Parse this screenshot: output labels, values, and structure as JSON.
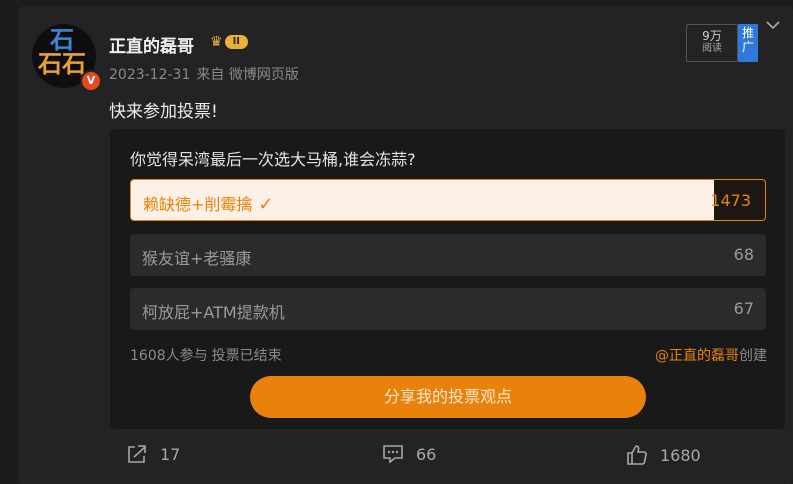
{
  "post": {
    "author": "正直的磊哥",
    "level": "II",
    "verified_mark": "V",
    "date": "2023-12-31",
    "source": "来自 微博网页版",
    "read_count": "9万",
    "read_label": "阅读",
    "recommend_label": "推广",
    "text": "快来参加投票!"
  },
  "avatar": {
    "chars": [
      "石",
      "石",
      "石"
    ]
  },
  "poll": {
    "question": "你觉得呆湾最后一次选大马桶,谁会冻蒜?",
    "options": [
      {
        "label": "赖缺德+削霉擒",
        "count": "1473",
        "share": 0.92,
        "selected": true
      },
      {
        "label": "猴友谊+老骚康",
        "count": "68",
        "share": 0.04,
        "selected": false
      },
      {
        "label": "柯放屁+ATM提款机",
        "count": "67",
        "share": 0.04,
        "selected": false
      }
    ],
    "participants": "1608人参与",
    "status": "投票已结束",
    "creator_mention": "@正直的磊哥",
    "creator_suffix": "创建",
    "share_button": "分享我的投票观点"
  },
  "actions": {
    "repost": {
      "icon": "share-icon",
      "count": "17"
    },
    "comment": {
      "icon": "comment-icon",
      "count": "66"
    },
    "like": {
      "icon": "thumb-up-icon",
      "count": "1680"
    }
  },
  "colors": {
    "accent": "#e8820c",
    "background": "#1c1c1e",
    "recommend": "#2f7ad8"
  }
}
